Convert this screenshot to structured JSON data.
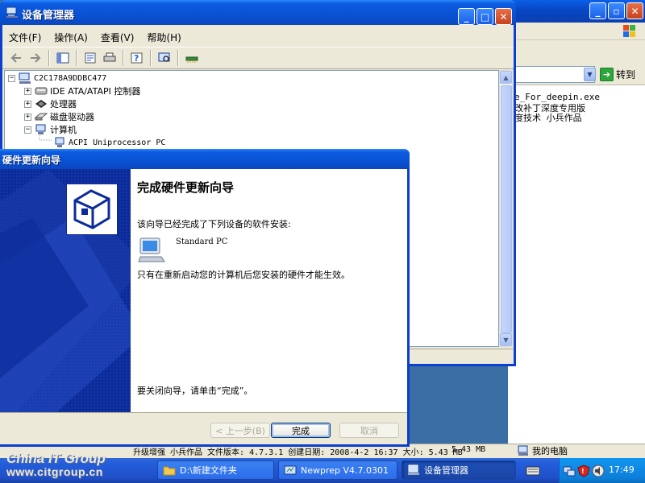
{
  "background_window": {
    "go_label": "转到",
    "text_lines": [
      "e_For_deepin.exe",
      "改补丁深度专用版",
      "度技术 小兵作品"
    ]
  },
  "device_manager": {
    "title": "设备管理器",
    "menus": [
      "文件(F)",
      "操作(A)",
      "查看(V)",
      "帮助(H)"
    ],
    "tree": {
      "root": "C2C178A9DDBC477",
      "items": [
        {
          "label": "IDE ATA/ATAPI 控制器",
          "expander": "+"
        },
        {
          "label": "处理器",
          "expander": "+"
        },
        {
          "label": "磁盘驱动器",
          "expander": "+"
        },
        {
          "label": "计算机",
          "expander": "−"
        }
      ],
      "child": "ACPI Uniprocessor PC"
    }
  },
  "wizard": {
    "title": "硬件更新向导",
    "heading": "完成硬件更新向导",
    "intro": "该向导已经完成了下列设备的软件安装:",
    "device_name": "Standard PC",
    "restart_note": "只有在重新启动您的计算机后您安装的硬件才能生效。",
    "close_hint": "要关闭向导，请单击“完成”。",
    "buttons": {
      "back": "< 上一步(B)",
      "finish": "完成",
      "cancel": "取消"
    }
  },
  "status_bar": {
    "file_info": "升级增强 小兵作品 文件版本: 4.7.3.1 创建日期: 2008-4-2 16:37 大小: 5.43 MB",
    "size": "5.43 MB",
    "location": "我的电脑"
  },
  "taskbar": {
    "items": [
      {
        "label": "D:\\新建文件夹"
      },
      {
        "label": "Newprep V4.7.0301"
      },
      {
        "label": "设备管理器"
      }
    ],
    "clock": "17:49"
  },
  "watermark": {
    "brand": "China IT Group",
    "url": "www.citgroup.cn"
  }
}
